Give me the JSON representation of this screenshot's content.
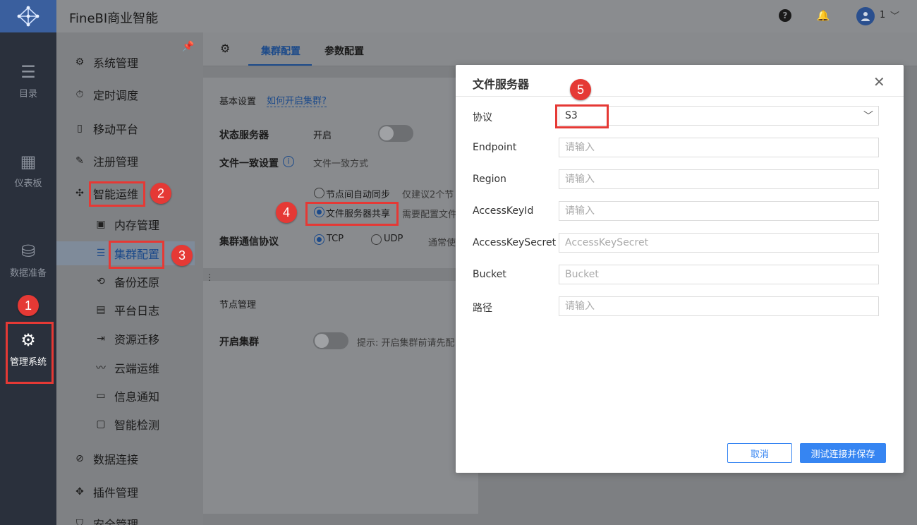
{
  "app": {
    "title": "FineBI商业智能",
    "user": "1"
  },
  "rail": {
    "items": [
      {
        "label": "目录",
        "icon": "list-icon"
      },
      {
        "label": "仪表板",
        "icon": "dashboard-icon"
      },
      {
        "label": "数据准备",
        "icon": "database-icon"
      },
      {
        "label": "管理系统",
        "icon": "gear-icon"
      }
    ]
  },
  "sidebar": {
    "items": [
      {
        "label": "系统管理"
      },
      {
        "label": "定时调度"
      },
      {
        "label": "移动平台"
      },
      {
        "label": "注册管理"
      },
      {
        "label": "智能运维"
      },
      {
        "label": "内存管理"
      },
      {
        "label": "集群配置"
      },
      {
        "label": "备份还原"
      },
      {
        "label": "平台日志"
      },
      {
        "label": "资源迁移"
      },
      {
        "label": "云端运维"
      },
      {
        "label": "信息通知"
      },
      {
        "label": "智能检测"
      },
      {
        "label": "数据连接"
      },
      {
        "label": "插件管理"
      },
      {
        "label": "安全管理"
      }
    ]
  },
  "tabs": [
    {
      "label": "集群配置"
    },
    {
      "label": "参数配置"
    }
  ],
  "basic": {
    "section": "基本设置",
    "help_link": "如何开启集群?",
    "status_server_label": "状态服务器",
    "status_server_value": "开启",
    "file_consistency_label": "文件一致设置",
    "file_consistency_placeholder": "文件一致方式",
    "opt_sync": "节点间自动同步",
    "opt_sync_hint": "仅建议2个节",
    "opt_share": "文件服务器共享",
    "opt_share_hint": "需要配置文件",
    "protocol_label": "集群通信协议",
    "tcp": "TCP",
    "udp": "UDP",
    "udp_hint": "通常使"
  },
  "nodes": {
    "section": "节点管理",
    "enable_label": "开启集群",
    "hint": "提示: 开启集群前请先配"
  },
  "modal": {
    "title": "文件服务器",
    "fields": [
      {
        "label": "协议",
        "value": "S3",
        "placeholder": ""
      },
      {
        "label": "Endpoint",
        "value": "",
        "placeholder": "请输入"
      },
      {
        "label": "Region",
        "value": "",
        "placeholder": "请输入"
      },
      {
        "label": "AccessKeyId",
        "value": "",
        "placeholder": "请输入"
      },
      {
        "label": "AccessKeySecret",
        "value": "",
        "placeholder": "AccessKeySecret"
      },
      {
        "label": "Bucket",
        "value": "",
        "placeholder": "Bucket"
      },
      {
        "label": "路径",
        "value": "",
        "placeholder": "请输入"
      }
    ],
    "cancel": "取消",
    "save": "测试连接并保存"
  },
  "annotations": [
    "1",
    "2",
    "3",
    "4",
    "5"
  ],
  "colors": {
    "accent": "#3685f2",
    "annotation": "#e53935",
    "rail": "#2a303c"
  }
}
